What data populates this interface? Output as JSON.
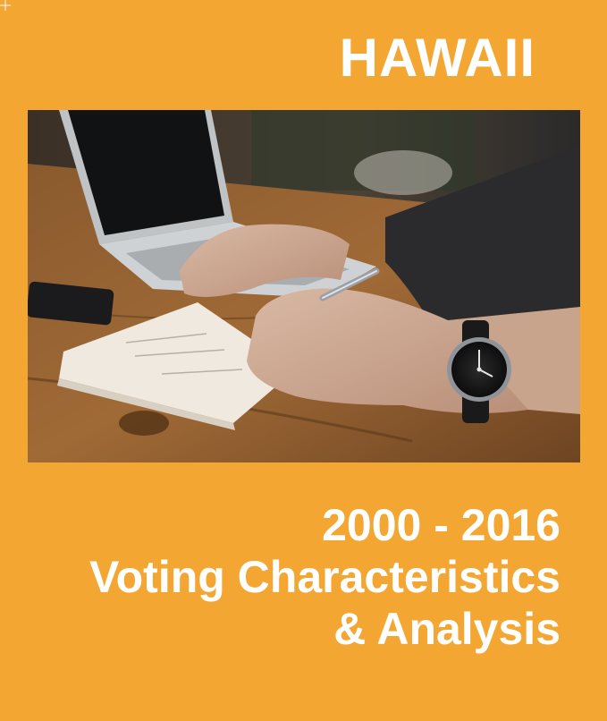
{
  "cover": {
    "state": "HAWAII",
    "headline_line1": "2000 - 2016",
    "headline_line2": "Voting Characteristics",
    "headline_line3": "& Analysis"
  },
  "colors": {
    "background": "#f4a633",
    "text": "#ffffff"
  },
  "photo": {
    "subject": "hand-writing-in-notebook-with-laptop-and-wristwatch"
  }
}
